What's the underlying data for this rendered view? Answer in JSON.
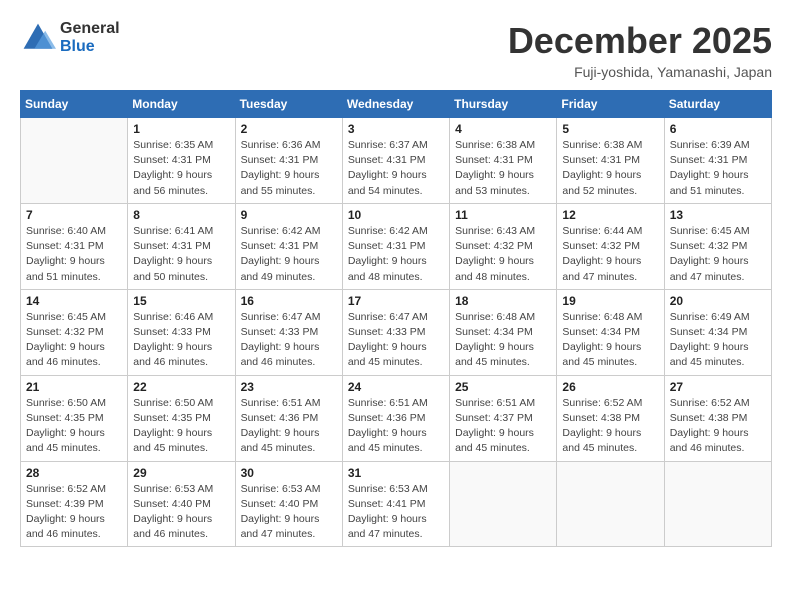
{
  "header": {
    "logo_general": "General",
    "logo_blue": "Blue",
    "month_title": "December 2025",
    "subtitle": "Fuji-yoshida, Yamanashi, Japan"
  },
  "days_of_week": [
    "Sunday",
    "Monday",
    "Tuesday",
    "Wednesday",
    "Thursday",
    "Friday",
    "Saturday"
  ],
  "weeks": [
    [
      {
        "day": "",
        "empty": true
      },
      {
        "day": "1",
        "sunrise": "Sunrise: 6:35 AM",
        "sunset": "Sunset: 4:31 PM",
        "daylight": "Daylight: 9 hours and 56 minutes."
      },
      {
        "day": "2",
        "sunrise": "Sunrise: 6:36 AM",
        "sunset": "Sunset: 4:31 PM",
        "daylight": "Daylight: 9 hours and 55 minutes."
      },
      {
        "day": "3",
        "sunrise": "Sunrise: 6:37 AM",
        "sunset": "Sunset: 4:31 PM",
        "daylight": "Daylight: 9 hours and 54 minutes."
      },
      {
        "day": "4",
        "sunrise": "Sunrise: 6:38 AM",
        "sunset": "Sunset: 4:31 PM",
        "daylight": "Daylight: 9 hours and 53 minutes."
      },
      {
        "day": "5",
        "sunrise": "Sunrise: 6:38 AM",
        "sunset": "Sunset: 4:31 PM",
        "daylight": "Daylight: 9 hours and 52 minutes."
      },
      {
        "day": "6",
        "sunrise": "Sunrise: 6:39 AM",
        "sunset": "Sunset: 4:31 PM",
        "daylight": "Daylight: 9 hours and 51 minutes."
      }
    ],
    [
      {
        "day": "7",
        "sunrise": "Sunrise: 6:40 AM",
        "sunset": "Sunset: 4:31 PM",
        "daylight": "Daylight: 9 hours and 51 minutes."
      },
      {
        "day": "8",
        "sunrise": "Sunrise: 6:41 AM",
        "sunset": "Sunset: 4:31 PM",
        "daylight": "Daylight: 9 hours and 50 minutes."
      },
      {
        "day": "9",
        "sunrise": "Sunrise: 6:42 AM",
        "sunset": "Sunset: 4:31 PM",
        "daylight": "Daylight: 9 hours and 49 minutes."
      },
      {
        "day": "10",
        "sunrise": "Sunrise: 6:42 AM",
        "sunset": "Sunset: 4:31 PM",
        "daylight": "Daylight: 9 hours and 48 minutes."
      },
      {
        "day": "11",
        "sunrise": "Sunrise: 6:43 AM",
        "sunset": "Sunset: 4:32 PM",
        "daylight": "Daylight: 9 hours and 48 minutes."
      },
      {
        "day": "12",
        "sunrise": "Sunrise: 6:44 AM",
        "sunset": "Sunset: 4:32 PM",
        "daylight": "Daylight: 9 hours and 47 minutes."
      },
      {
        "day": "13",
        "sunrise": "Sunrise: 6:45 AM",
        "sunset": "Sunset: 4:32 PM",
        "daylight": "Daylight: 9 hours and 47 minutes."
      }
    ],
    [
      {
        "day": "14",
        "sunrise": "Sunrise: 6:45 AM",
        "sunset": "Sunset: 4:32 PM",
        "daylight": "Daylight: 9 hours and 46 minutes."
      },
      {
        "day": "15",
        "sunrise": "Sunrise: 6:46 AM",
        "sunset": "Sunset: 4:33 PM",
        "daylight": "Daylight: 9 hours and 46 minutes."
      },
      {
        "day": "16",
        "sunrise": "Sunrise: 6:47 AM",
        "sunset": "Sunset: 4:33 PM",
        "daylight": "Daylight: 9 hours and 46 minutes."
      },
      {
        "day": "17",
        "sunrise": "Sunrise: 6:47 AM",
        "sunset": "Sunset: 4:33 PM",
        "daylight": "Daylight: 9 hours and 45 minutes."
      },
      {
        "day": "18",
        "sunrise": "Sunrise: 6:48 AM",
        "sunset": "Sunset: 4:34 PM",
        "daylight": "Daylight: 9 hours and 45 minutes."
      },
      {
        "day": "19",
        "sunrise": "Sunrise: 6:48 AM",
        "sunset": "Sunset: 4:34 PM",
        "daylight": "Daylight: 9 hours and 45 minutes."
      },
      {
        "day": "20",
        "sunrise": "Sunrise: 6:49 AM",
        "sunset": "Sunset: 4:34 PM",
        "daylight": "Daylight: 9 hours and 45 minutes."
      }
    ],
    [
      {
        "day": "21",
        "sunrise": "Sunrise: 6:50 AM",
        "sunset": "Sunset: 4:35 PM",
        "daylight": "Daylight: 9 hours and 45 minutes."
      },
      {
        "day": "22",
        "sunrise": "Sunrise: 6:50 AM",
        "sunset": "Sunset: 4:35 PM",
        "daylight": "Daylight: 9 hours and 45 minutes."
      },
      {
        "day": "23",
        "sunrise": "Sunrise: 6:51 AM",
        "sunset": "Sunset: 4:36 PM",
        "daylight": "Daylight: 9 hours and 45 minutes."
      },
      {
        "day": "24",
        "sunrise": "Sunrise: 6:51 AM",
        "sunset": "Sunset: 4:36 PM",
        "daylight": "Daylight: 9 hours and 45 minutes."
      },
      {
        "day": "25",
        "sunrise": "Sunrise: 6:51 AM",
        "sunset": "Sunset: 4:37 PM",
        "daylight": "Daylight: 9 hours and 45 minutes."
      },
      {
        "day": "26",
        "sunrise": "Sunrise: 6:52 AM",
        "sunset": "Sunset: 4:38 PM",
        "daylight": "Daylight: 9 hours and 45 minutes."
      },
      {
        "day": "27",
        "sunrise": "Sunrise: 6:52 AM",
        "sunset": "Sunset: 4:38 PM",
        "daylight": "Daylight: 9 hours and 46 minutes."
      }
    ],
    [
      {
        "day": "28",
        "sunrise": "Sunrise: 6:52 AM",
        "sunset": "Sunset: 4:39 PM",
        "daylight": "Daylight: 9 hours and 46 minutes."
      },
      {
        "day": "29",
        "sunrise": "Sunrise: 6:53 AM",
        "sunset": "Sunset: 4:40 PM",
        "daylight": "Daylight: 9 hours and 46 minutes."
      },
      {
        "day": "30",
        "sunrise": "Sunrise: 6:53 AM",
        "sunset": "Sunset: 4:40 PM",
        "daylight": "Daylight: 9 hours and 47 minutes."
      },
      {
        "day": "31",
        "sunrise": "Sunrise: 6:53 AM",
        "sunset": "Sunset: 4:41 PM",
        "daylight": "Daylight: 9 hours and 47 minutes."
      },
      {
        "day": "",
        "empty": true
      },
      {
        "day": "",
        "empty": true
      },
      {
        "day": "",
        "empty": true
      }
    ]
  ]
}
